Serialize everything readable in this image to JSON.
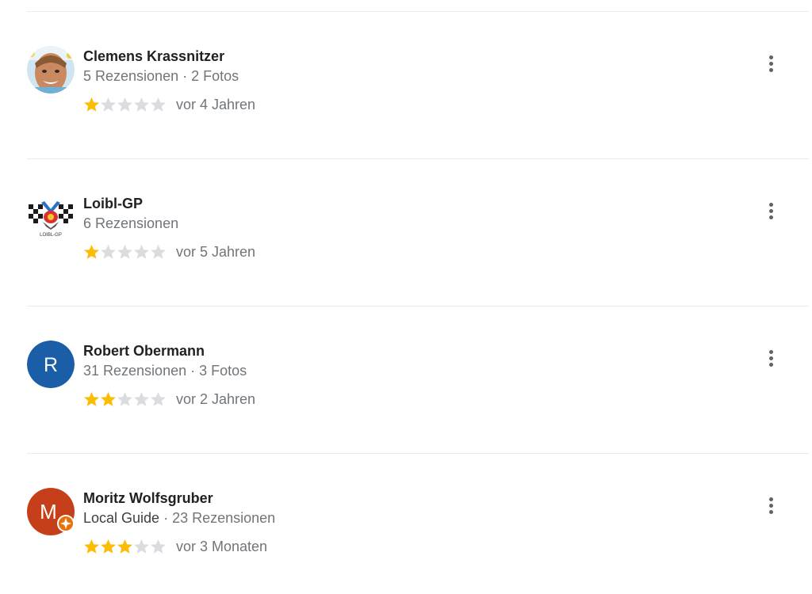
{
  "reviews": [
    {
      "name": "Clemens Krassnitzer",
      "meta": "5 Rezensionen · 2 Fotos",
      "guide_label": "",
      "rating": 1,
      "date": "vor 4 Jahren",
      "avatar": "photo"
    },
    {
      "name": "Loibl-GP",
      "meta": "6 Rezensionen",
      "guide_label": "",
      "rating": 1,
      "date": "vor 5 Jahren",
      "avatar": "logo",
      "avatar_logo_text": "LOIBL-GP"
    },
    {
      "name": "Robert Obermann",
      "meta": "31 Rezensionen · 3 Fotos",
      "guide_label": "",
      "rating": 2,
      "date": "vor 2 Jahren",
      "avatar": "letter",
      "avatar_letter": "R",
      "avatar_color": "#1a5ea8"
    },
    {
      "name": "Moritz Wolfsgruber",
      "meta": " · 23 Rezensionen",
      "guide_label": "Local Guide",
      "rating": 3,
      "date": "vor 3 Monaten",
      "avatar": "letter",
      "avatar_letter": "M",
      "avatar_color": "#c5401a",
      "local_guide_badge_color": "#e8710a"
    }
  ],
  "max_rating": 5,
  "colors": {
    "star_filled": "#fbbc04",
    "star_empty": "#dadce0"
  }
}
